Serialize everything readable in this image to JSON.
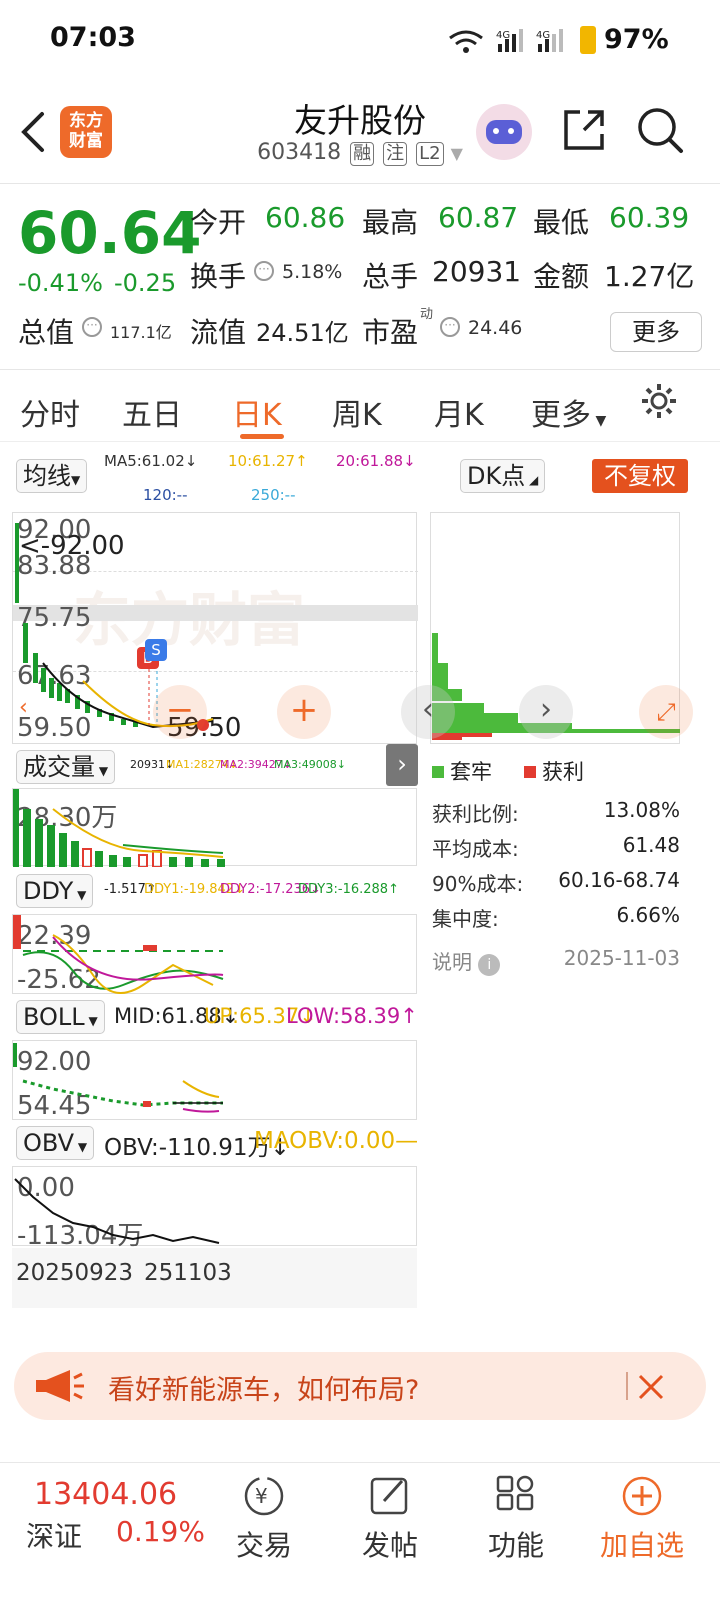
{
  "status_bar": {
    "time": "07:03",
    "battery": "97%"
  },
  "header": {
    "logo": "东方\n财富",
    "title": "友升股份",
    "code": "603418",
    "tags": [
      "融",
      "注",
      "L2"
    ]
  },
  "quote": {
    "price": "60.64",
    "change_pct": "-0.41%",
    "change": "-0.25",
    "open_label": "今开",
    "open": "60.86",
    "high_label": "最高",
    "high": "60.87",
    "low_label": "最低",
    "low": "60.39",
    "turnover_label": "换手",
    "turnover": "5.18%",
    "volume_label": "总手",
    "volume": "20931",
    "amount_label": "金额",
    "amount": "1.27亿",
    "mktcap_label": "总值",
    "mktcap": "117.1亿",
    "float_label": "流值",
    "float_cap": "24.51亿",
    "pe_label": "市盈",
    "pe_sup": "动",
    "pe": "24.46",
    "more": "更多"
  },
  "tabs": [
    "分时",
    "五日",
    "日K",
    "周K",
    "月K",
    "更多"
  ],
  "chart": {
    "indicator_select": "均线",
    "ma5": "MA5:61.02↓",
    "ma10": "10:61.27↑",
    "ma20": "20:61.88↓",
    "ma120": "120:--",
    "ma250": "250:--",
    "dk_select": "DK点",
    "adjust_btn": "不复权",
    "price_axis": [
      "92.00",
      "83.88",
      "75.75",
      "67.63",
      "59.50"
    ],
    "high_marker": "<-92.00",
    "low_marker": "59.50",
    "watermark": "东方财富",
    "s_badge": "S",
    "b_badge": "B",
    "volume_select": "成交量",
    "vol_values": {
      "v": "20931↓",
      "ma1": "MA1:28274↓",
      "ma2": "MA2:39427↓",
      "ma3": "MA3:49008↓"
    },
    "vol_axis": "28.30万",
    "ddy_select": "DDY",
    "ddy_values": {
      "ddy": "-1.517↑",
      "ddy1": "DDY1:-19.842↓",
      "ddy2": "DDY2:-17.236↓",
      "ddy3": "DDY3:-16.288↑"
    },
    "ddy_axis": [
      "22.39",
      "-25.62"
    ],
    "boll_select": "BOLL",
    "boll_values": {
      "mid": "MID:61.88↓",
      "up": "UP:65.37↓",
      "low": "LOW:58.39↑"
    },
    "boll_axis": [
      "92.00",
      "54.45"
    ],
    "obv_select": "OBV",
    "obv_values": {
      "obv": "OBV:-110.91万↓",
      "maobv": "MAOBV:0.00—"
    },
    "obv_axis": [
      "0.00",
      "-113.04万"
    ],
    "date_start": "20250923",
    "date_end": "251103"
  },
  "chip": {
    "legend_trapped": "套牢",
    "legend_profit": "获利",
    "rows": [
      {
        "label": "获利比例:",
        "value": "13.08%"
      },
      {
        "label": "平均成本:",
        "value": "61.48"
      },
      {
        "label": "90%成本:",
        "value": "60.16-68.74"
      },
      {
        "label": "集中度:",
        "value": "6.66%"
      }
    ],
    "note_label": "说明",
    "date": "2025-11-03"
  },
  "banner": {
    "text": "看好新能源车，如何布局?"
  },
  "bottom": {
    "index_value": "13404.06",
    "index_name": "深证",
    "index_change": "0.19%",
    "trade": "交易",
    "post": "发帖",
    "func": "功能",
    "add": "加自选"
  },
  "colors": {
    "accent": "#ee6a2a",
    "down": "#1a9a2c",
    "up": "#e23b30",
    "ma10": "#e8b400",
    "ma20": "#c0189a"
  }
}
